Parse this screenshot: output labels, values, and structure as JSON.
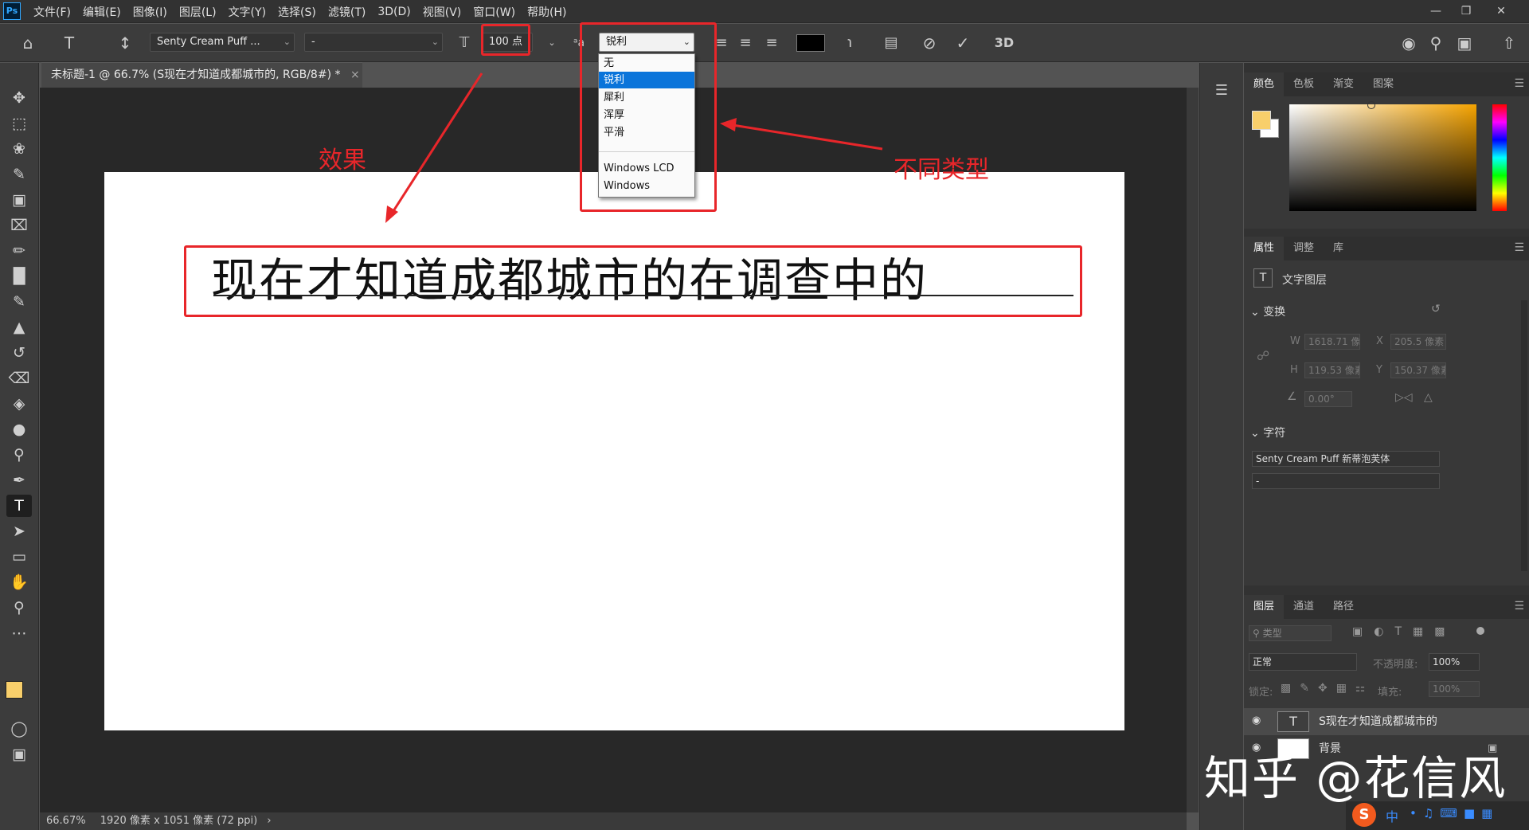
{
  "menubar": {
    "app_icon": "Ps",
    "items": [
      "文件(F)",
      "编辑(E)",
      "图像(I)",
      "图层(L)",
      "文字(Y)",
      "选择(S)",
      "滤镜(T)",
      "3D(D)",
      "视图(V)",
      "窗口(W)",
      "帮助(H)"
    ],
    "window_controls": [
      "minimize-icon",
      "restore-icon",
      "close-icon"
    ]
  },
  "options": {
    "font_family": "Senty Cream Puff ...",
    "font_style": "-",
    "font_size": "100 点",
    "antialias_value": "锐利",
    "text_color": "#000000",
    "btn_3d": "3D"
  },
  "antialias_menu": {
    "options": [
      "无",
      "锐利",
      "犀利",
      "浑厚",
      "平滑",
      "Windows LCD",
      "Windows"
    ],
    "selected": "锐利"
  },
  "annotations": {
    "effect": "效果",
    "types": "不同类型",
    "color": "#e8262a"
  },
  "document": {
    "tab_title": "未标题-1 @ 66.7% (S现在才知道成都城市的, RGB/8#) *",
    "text_content": "现在才知道成都城市的在调查中的",
    "zoom": "66.67%",
    "doc_info": "1920 像素 x 1051 像素 (72 ppi)"
  },
  "color_panel": {
    "tabs": [
      "颜色",
      "色板",
      "渐变",
      "图案"
    ],
    "foreground": "#f8cf6b",
    "background": "#ffffff",
    "hue": "#f5a300"
  },
  "properties_panel": {
    "tabs": [
      "属性",
      "调整",
      "库"
    ],
    "layer_type": "文字图层",
    "transform_title": "变换",
    "w_label": "W",
    "w_value": "1618.71 像",
    "x_label": "X",
    "x_value": "205.5 像素",
    "h_label": "H",
    "h_value": "119.53 像素",
    "y_label": "Y",
    "y_value": "150.37 像素",
    "angle_value": "0.00°",
    "character_title": "字符",
    "char_font": "Senty Cream Puff 新蒂泡芙体",
    "char_style": "-"
  },
  "layers_panel": {
    "tabs": [
      "图层",
      "通道",
      "路径"
    ],
    "search_placeholder": "类型",
    "blend_mode": "正常",
    "opacity_label": "不透明度:",
    "opacity_value": "100%",
    "lock_label": "锁定:",
    "fill_label": "填充:",
    "fill_value": "100%",
    "layers": [
      {
        "name": "S现在才知道成都城市的",
        "type": "text",
        "selected": true
      },
      {
        "name": "背景",
        "type": "background",
        "selected": false
      }
    ]
  },
  "watermark": "知乎 @花信风",
  "ime": {
    "label": "中"
  }
}
